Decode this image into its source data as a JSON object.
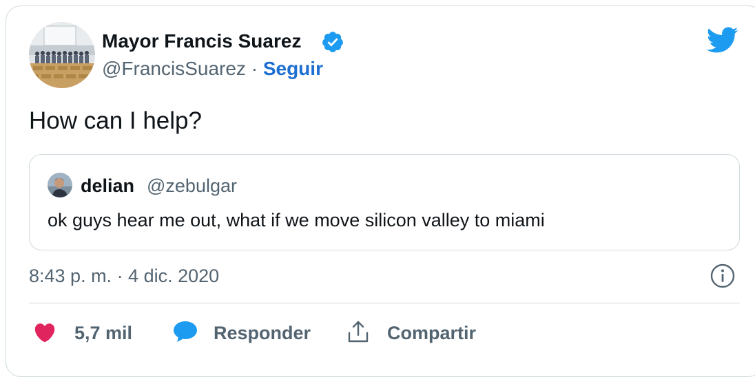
{
  "author": {
    "name": "Mayor Francis Suarez",
    "handle": "@FrancisSuarez",
    "separator": "·",
    "follow_label": "Seguir",
    "verified": true
  },
  "tweet": {
    "text": "How can I help?"
  },
  "quoted_tweet": {
    "name": "delian",
    "handle": "@zebulgar",
    "text": "ok guys hear me out, what if we move silicon valley to miami"
  },
  "meta": {
    "timestamp": "8:43 p. m. · 4 dic. 2020"
  },
  "actions": {
    "like_count": "5,7 mil",
    "reply_label": "Responder",
    "share_label": "Compartir"
  },
  "icons": {
    "logo": "twitter-bird-icon",
    "verified": "verified-badge-icon",
    "info": "info-icon",
    "like": "heart-icon",
    "reply": "speech-bubble-icon",
    "share": "share-arrow-icon"
  },
  "colors": {
    "brand_blue": "#1d9bf0",
    "link_blue": "#1d6ed1",
    "like_pink": "#e0245e",
    "secondary_text": "#536471",
    "border": "#cfd9de"
  }
}
